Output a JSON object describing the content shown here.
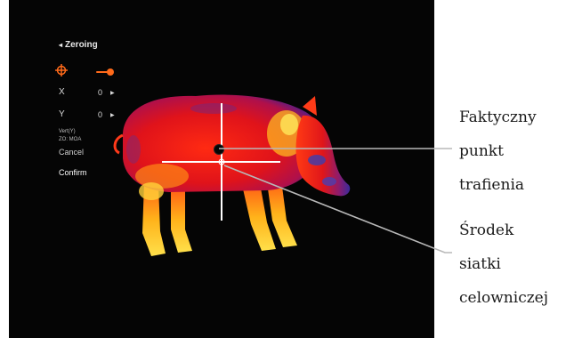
{
  "menu": {
    "title": "Zeroing",
    "title_icon": "chevron-left-icon",
    "crosshair_icon": "crosshair-icon",
    "toggle_on": true,
    "x_label": "X",
    "x_value": "0",
    "y_label": "Y",
    "y_value": "0",
    "vert_label": "Vert(Y)",
    "zo_label": "ZO: MOA",
    "cancel_label": "Cancel",
    "confirm_label": "Confirm"
  },
  "callouts": {
    "hit_point": [
      "Faktyczny",
      "punkt",
      "trafienia"
    ],
    "reticle_center": [
      "Środek",
      "siatki",
      "celowniczej"
    ]
  },
  "colors": {
    "accent": "#ff6a1a",
    "background": "#050505",
    "reticle": "#ffffff",
    "leader": "#b8b8b8"
  }
}
